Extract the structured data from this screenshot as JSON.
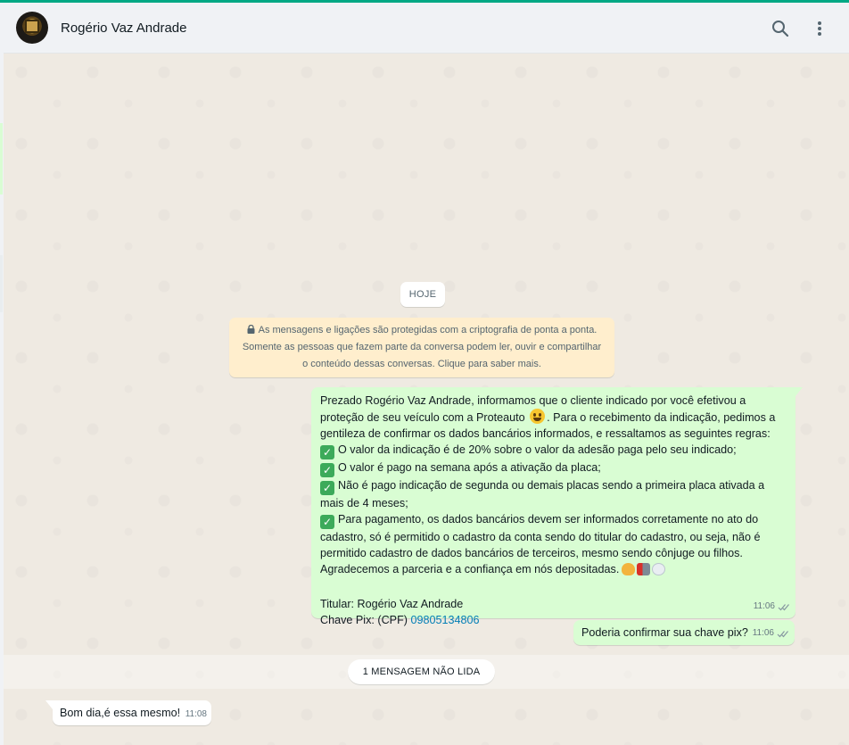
{
  "header": {
    "contact_name": "Rogério Vaz Andrade",
    "icons": [
      "search-icon",
      "menu-icon"
    ]
  },
  "chat": {
    "date_label": "HOJE",
    "encryption_notice": {
      "line1": "As mensagens e ligações são protegidas com a criptografia de ponta a ponta.",
      "line2": "Somente as pessoas que fazem parte da conversa podem ler, ouvir e compartilhar",
      "line3": "o conteúdo dessas conversas. Clique para saber mais."
    },
    "messages": [
      {
        "direction": "outgoing",
        "lines": {
          "l1": "Prezado Rogério Vaz Andrade, informamos que o cliente indicado por você efetivou a",
          "l2a": "proteção de seu veículo com a Proteauto",
          "l2b": ". Para o recebimento da indicação, pedimos a",
          "l3": "gentileza de confirmar os dados bancários informados, e  ressaltamos as seguintes regras:",
          "l4": "O valor da indicação é de 20% sobre o valor da adesão paga pelo seu indicado;",
          "l5": "O valor é pago na semana após a ativação da placa;",
          "l6": "Não é pago indicação de segunda ou demais placas sendo a primeira placa ativada a",
          "l7": "mais de 4 meses;",
          "l8": "Para pagamento, os dados bancários devem ser informados corretamente no ato do",
          "l9": "cadastro, só é permitido o cadastro da conta sendo do titular do cadastro, ou seja, não é",
          "l10": "permitido cadastro de dados bancários de terceiros, mesmo sendo cônjuge ou filhos.",
          "l11": "Agradecemos a parceria e a confiança em nós depositadas.",
          "l12": "Titular: Rogério Vaz Andrade",
          "l13a": "Chave Pix: (CPF) ",
          "l13b": "09805134806"
        },
        "time": "11:06"
      },
      {
        "direction": "outgoing",
        "text": "Poderia confirmar sua chave pix?",
        "time": "11:06"
      }
    ],
    "unread_label": "1 MENSAGEM NÃO LIDA",
    "incoming": {
      "direction": "incoming",
      "text": "Bom dia,é essa mesmo!",
      "time": "11:08"
    }
  },
  "colors": {
    "accent": "#00a884",
    "outgoing_bubble": "#d9fdd3",
    "incoming_bubble": "#ffffff",
    "notice_bg": "#ffeecd",
    "chat_bg": "#efeae2",
    "link": "#027eb5"
  }
}
